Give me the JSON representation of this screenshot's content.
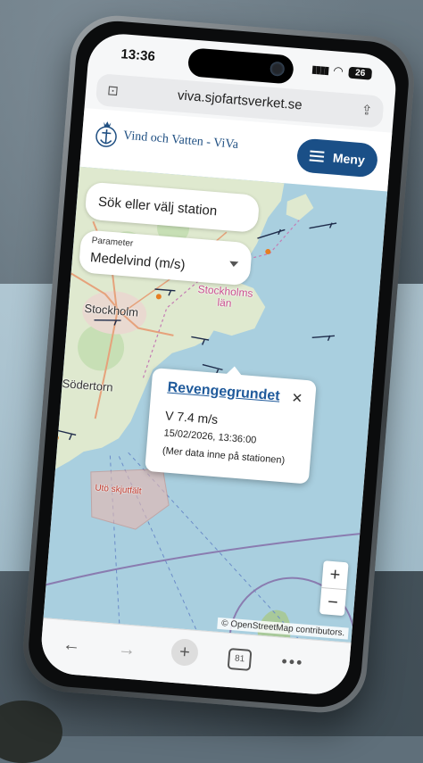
{
  "status_bar": {
    "time": "13:36",
    "battery": "26"
  },
  "browser": {
    "url": "viva.sjofartsverket.se",
    "tab_count": "81"
  },
  "app": {
    "brand": "Vind och Vatten - ViVa",
    "menu_label": "Meny"
  },
  "controls": {
    "search_placeholder": "Sök eller välj station",
    "parameter_label": "Parameter",
    "parameter_value": "Medelvind (m/s)"
  },
  "popup": {
    "station": "Revengegrundet",
    "wind": "V 7.4 m/s",
    "timestamp": "15/02/2026, 13:36:00",
    "more": "(Mer data inne på stationen)"
  },
  "map_labels": {
    "stockholm": "Stockholm",
    "stockholms_lan": "Stockholms län",
    "sodertorn": "Södertorn",
    "uto": "Utö skjutfält"
  },
  "map": {
    "zoom_in": "+",
    "zoom_out": "−",
    "attribution": "© OpenStreetMap contributors."
  },
  "colors": {
    "menu_button": "#1a4f87",
    "link": "#1f5a9b",
    "sea": "#a9cfdf",
    "land": "#dfe9cf"
  }
}
